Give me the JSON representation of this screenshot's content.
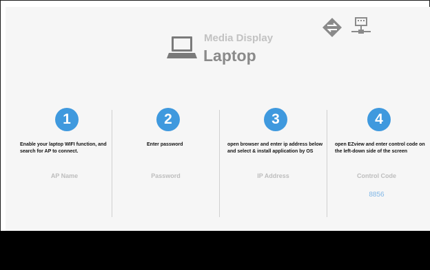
{
  "header": {
    "subtitle": "Media Display",
    "title": "Laptop",
    "icons": [
      "laptop-icon",
      "network-diamond-icon",
      "lan-icon"
    ]
  },
  "steps": [
    {
      "number": "1",
      "instruction": "Enable your laptop WIFI function, and search for AP to connect.",
      "label": "AP Name",
      "value": ""
    },
    {
      "number": "2",
      "instruction": "Enter password",
      "label": "Password",
      "value": ""
    },
    {
      "number": "3",
      "instruction": "open browser and enter ip address below and select & install application by OS",
      "label": "IP Address",
      "value": ""
    },
    {
      "number": "4",
      "instruction": "open EZview and enter control code on the left-down side of the screen",
      "label": "Control Code",
      "value": "8856"
    }
  ],
  "colors": {
    "accent": "#3f99de",
    "value_text": "#7fb6e6",
    "label_text": "#bdbdbd",
    "title_text": "#8a8a8a",
    "screen_bg": "#f6f6f6"
  }
}
